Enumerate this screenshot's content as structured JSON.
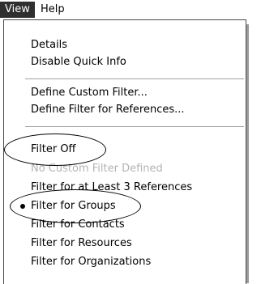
{
  "menubar": {
    "items": [
      {
        "label": "View",
        "active": true
      },
      {
        "label": "Help",
        "active": false
      }
    ]
  },
  "menu": {
    "items": [
      {
        "label": "Details",
        "enabled": true
      },
      {
        "label": "Disable Quick Info",
        "enabled": true
      },
      {
        "separator": true
      },
      {
        "label": "Define Custom Filter...",
        "enabled": true
      },
      {
        "label": "Define Filter for References...",
        "enabled": true
      },
      {
        "separator": true
      },
      {
        "label": "Filter Off",
        "enabled": true,
        "highlighted_with_circle": true
      },
      {
        "label": "No Custom Filter Defined",
        "enabled": false
      },
      {
        "label": "Filter for at Least 3 References",
        "enabled": true
      },
      {
        "label": "Filter for Groups",
        "enabled": true,
        "checked": true,
        "highlighted_with_circle": true
      },
      {
        "label": "Filter for Contacts",
        "enabled": true
      },
      {
        "label": "Filter for Resources",
        "enabled": true
      },
      {
        "label": "Filter for Organizations",
        "enabled": true
      }
    ]
  },
  "colors": {
    "active_menu_bg": "#2f2f2f",
    "disabled_text": "#b3b3b3",
    "annotation": "#000000"
  }
}
